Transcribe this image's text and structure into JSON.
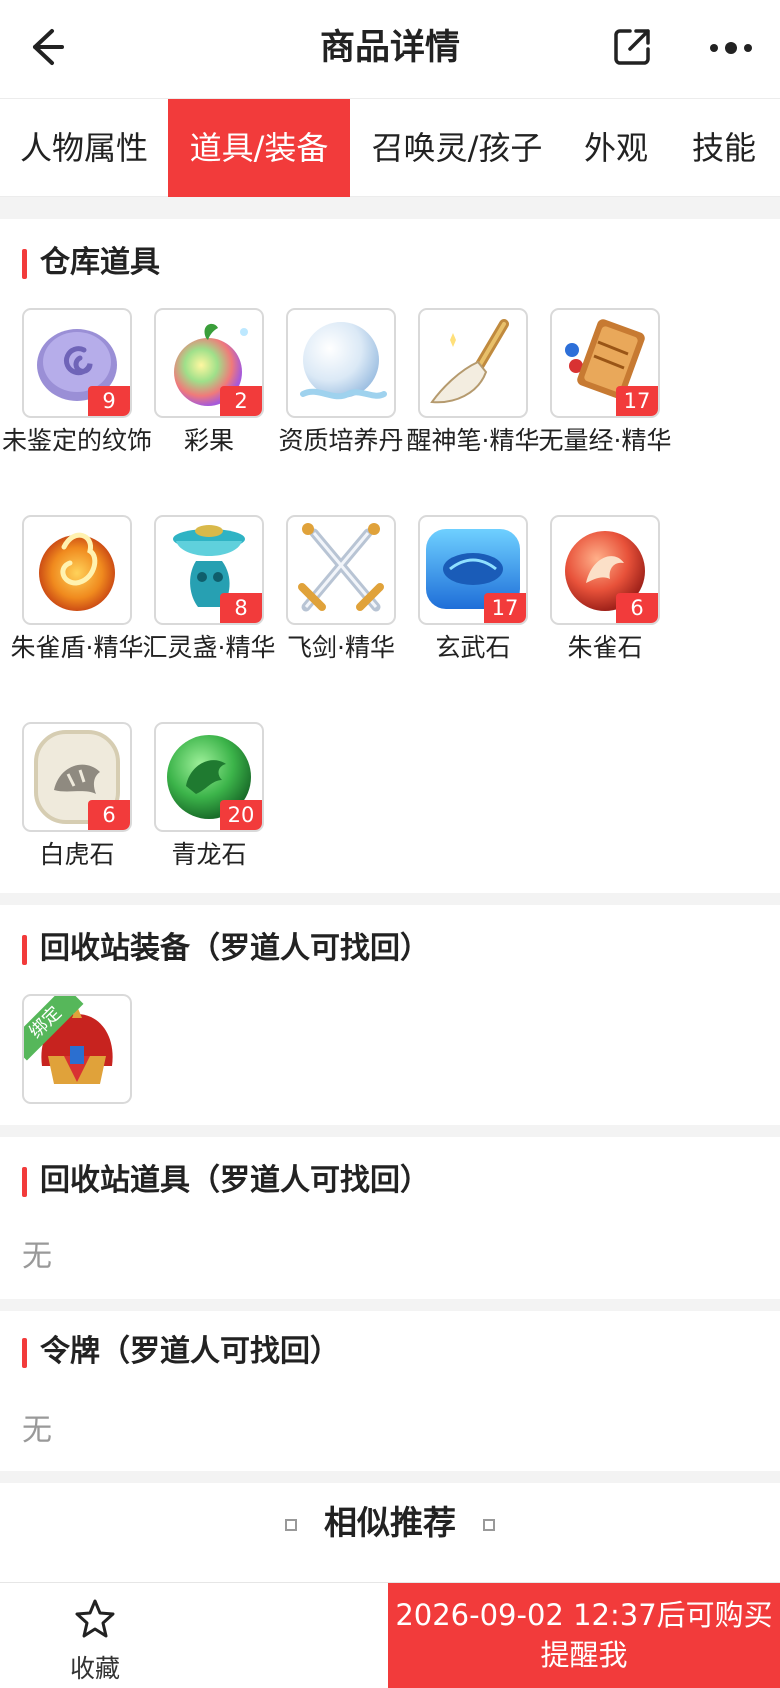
{
  "header": {
    "title": "商品详情"
  },
  "tabs": [
    {
      "label": "人物属性",
      "active": false
    },
    {
      "label": "道具/装备",
      "active": true
    },
    {
      "label": "召唤灵/孩子",
      "active": false
    },
    {
      "label": "外观",
      "active": false
    },
    {
      "label": "技能",
      "active": false
    }
  ],
  "warehouse": {
    "title": "仓库道具",
    "items": [
      {
        "name": "未鉴定的纹饰",
        "count": "9",
        "icon": "purple-swirl-stone-icon"
      },
      {
        "name": "彩果",
        "count": "2",
        "icon": "rainbow-fruit-icon"
      },
      {
        "name": "资质培养丹",
        "count": "",
        "icon": "white-pearl-icon"
      },
      {
        "name": "醒神笔·精华",
        "count": "",
        "icon": "brush-icon"
      },
      {
        "name": "无量经·精华",
        "count": "17",
        "icon": "scroll-icon"
      },
      {
        "name": "朱雀盾·精华",
        "count": "",
        "icon": "fire-shield-icon"
      },
      {
        "name": "汇灵盏·精华",
        "count": "8",
        "icon": "jade-cup-icon"
      },
      {
        "name": "飞剑·精华",
        "count": "",
        "icon": "crossed-swords-icon"
      },
      {
        "name": "玄武石",
        "count": "17",
        "icon": "blue-turtle-stone-icon"
      },
      {
        "name": "朱雀石",
        "count": "6",
        "icon": "red-phoenix-stone-icon"
      },
      {
        "name": "白虎石",
        "count": "6",
        "icon": "white-tiger-stone-icon"
      },
      {
        "name": "青龙石",
        "count": "20",
        "icon": "green-dragon-stone-icon"
      }
    ]
  },
  "recycle_equipment": {
    "title": "回收站装备（罗道人可找回）",
    "items": [
      {
        "tag": "绑定",
        "icon": "red-helmet-icon"
      }
    ]
  },
  "recycle_items": {
    "title": "回收站道具（罗道人可找回）",
    "empty_text": "无"
  },
  "tokens": {
    "title": "令牌（罗道人可找回）",
    "empty_text": "无"
  },
  "recommend": {
    "title": "相似推荐"
  },
  "bottom": {
    "favorite_label": "收藏",
    "buy_line1": "2026-09-02 12:37后可购买",
    "buy_line2": "提醒我"
  },
  "colors": {
    "accent": "#f23b3b",
    "bind_tag": "#56b75a"
  }
}
